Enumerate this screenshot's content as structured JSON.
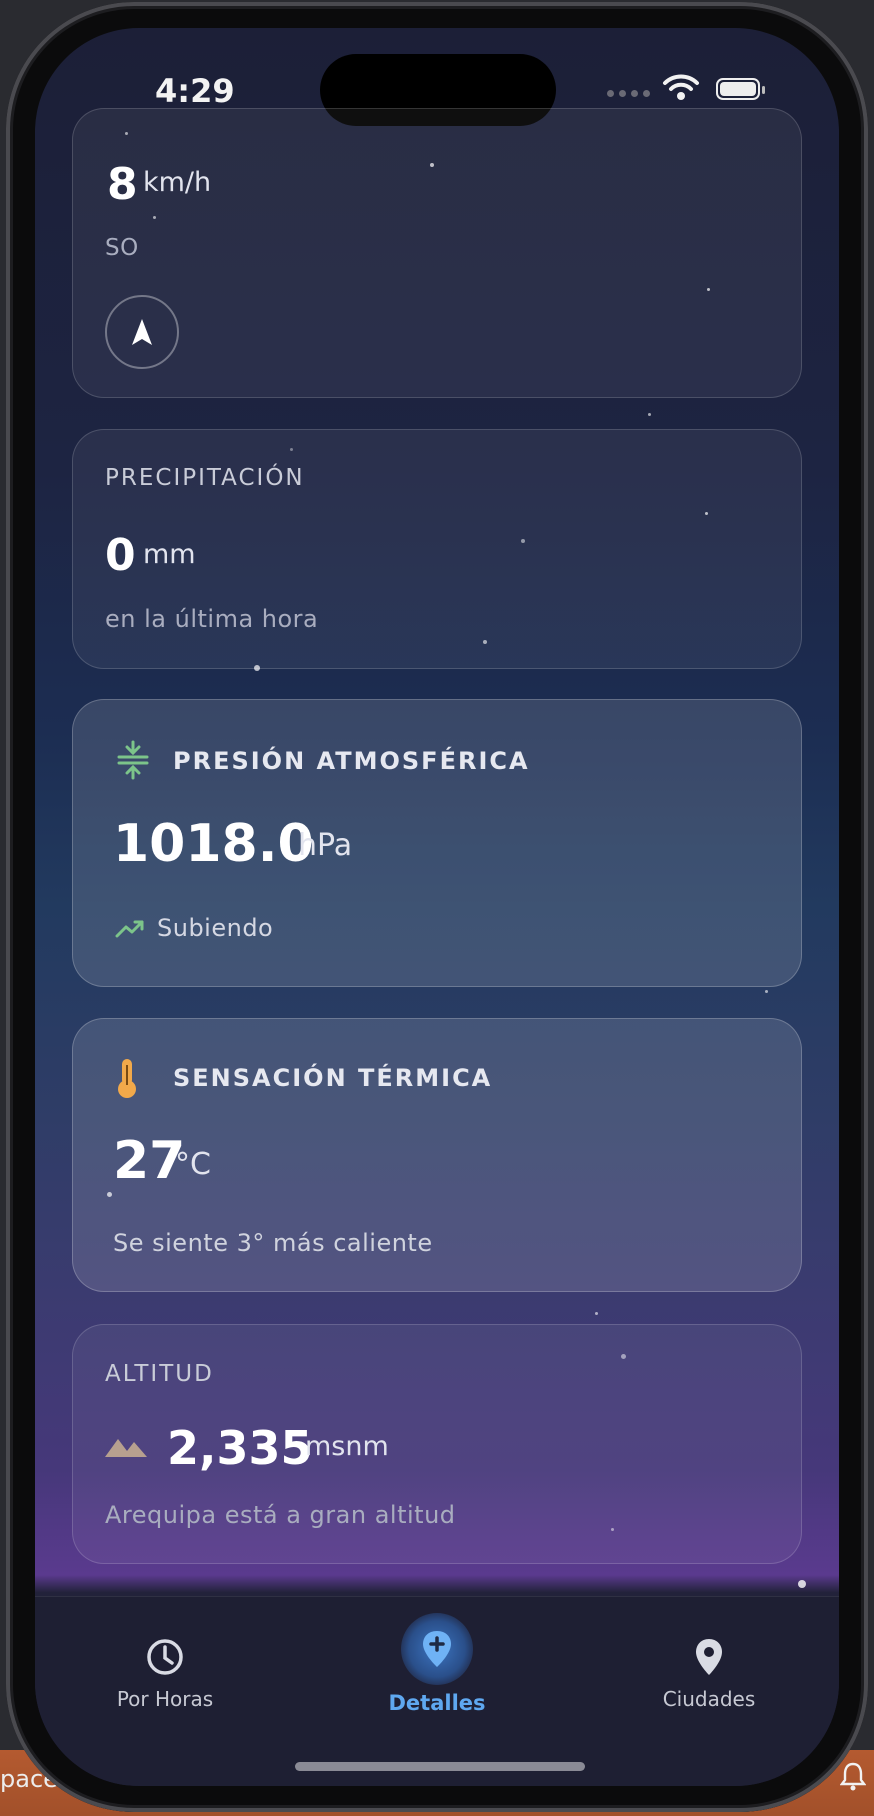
{
  "desktop": {
    "left_text": "paces"
  },
  "status_bar": {
    "time": "4:29"
  },
  "wind_card": {
    "value": "8",
    "unit": "km/h",
    "direction": "SO"
  },
  "precipitation_card": {
    "title": "PRECIPITACIÓN",
    "value": "0",
    "unit": "mm",
    "note": "en la última hora"
  },
  "pressure_card": {
    "title": "PRESIÓN ATMOSFÉRICA",
    "value": "1018.0",
    "unit": "hPa",
    "trend": "Subiendo"
  },
  "feels_like_card": {
    "title": "SENSACIÓN TÉRMICA",
    "value": "27",
    "unit": "°C",
    "note": "Se siente 3° más caliente"
  },
  "altitude_card": {
    "title": "ALTITUD",
    "value": "2,335",
    "unit": "msnm",
    "note": "Arequipa está a gran altitud"
  },
  "tab_bar": {
    "tabs": [
      {
        "label": "Por Horas",
        "icon": "clock-icon"
      },
      {
        "label": "Detalles",
        "icon": "location-plus-icon",
        "active": true
      },
      {
        "label": "Ciudades",
        "icon": "map-pin-icon"
      }
    ]
  },
  "colors": {
    "accent_blue": "#5fa8f0",
    "pressure_green": "#7cc48a",
    "thermo_orange": "#f2a94a",
    "mountain_tan": "#b7a08f"
  }
}
